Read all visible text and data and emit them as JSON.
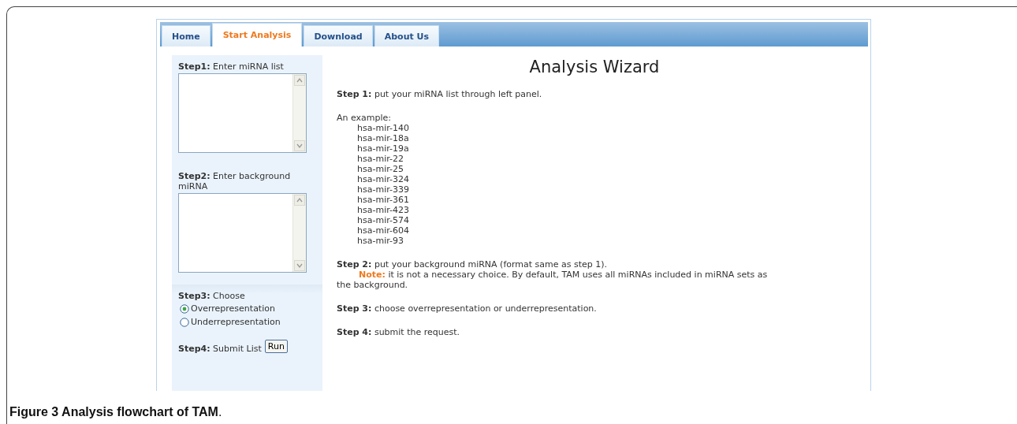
{
  "tabs": [
    {
      "label": "Home",
      "selected": false
    },
    {
      "label": "Start Analysis",
      "selected": true
    },
    {
      "label": "Download",
      "selected": false
    },
    {
      "label": "About Us",
      "selected": false
    }
  ],
  "left_panel": {
    "steps": [
      {
        "kind": "textarea",
        "label": "**Step1:** Enter miRNA list"
      },
      {
        "kind": "textarea",
        "label": "**Step2:** Enter background miRNA"
      },
      {
        "kind": "radio",
        "label": "**Step3:** Choose",
        "options": [
          {
            "label": "Overrepresentation",
            "selected": true
          },
          {
            "label": "Underrepresentation",
            "selected": false
          }
        ]
      },
      {
        "kind": "submit",
        "label": "**Step4:** Submit List",
        "button": "Run"
      }
    ]
  },
  "main": {
    "title": "Analysis Wizard",
    "blocks": [
      {
        "kind": "step",
        "text": "**Step 1:** put your miRNA list through left panel."
      },
      {
        "kind": "example",
        "heading": "An example:",
        "items": [
          "hsa-mir-140",
          "hsa-mir-18a",
          "hsa-mir-19a",
          "hsa-mir-22",
          "hsa-mir-25",
          "hsa-mir-324",
          "hsa-mir-339",
          "hsa-mir-361",
          "hsa-mir-423",
          "hsa-mir-574",
          "hsa-mir-604",
          "hsa-mir-93"
        ]
      },
      {
        "kind": "step",
        "text": "**Step 2:** put your background miRNA (format same as step 1).",
        "note_label": "Note:",
        "note": "it is not a necessary choice. By default, TAM uses all miRNAs included in miRNA sets as the background."
      },
      {
        "kind": "step",
        "text": "**Step 3:** choose overrepresentation or underrepresentation."
      },
      {
        "kind": "step",
        "text": "**Step 4:** submit the request."
      }
    ]
  },
  "caption": "**Figure 3 Analysis flowchart of TAM**."
}
